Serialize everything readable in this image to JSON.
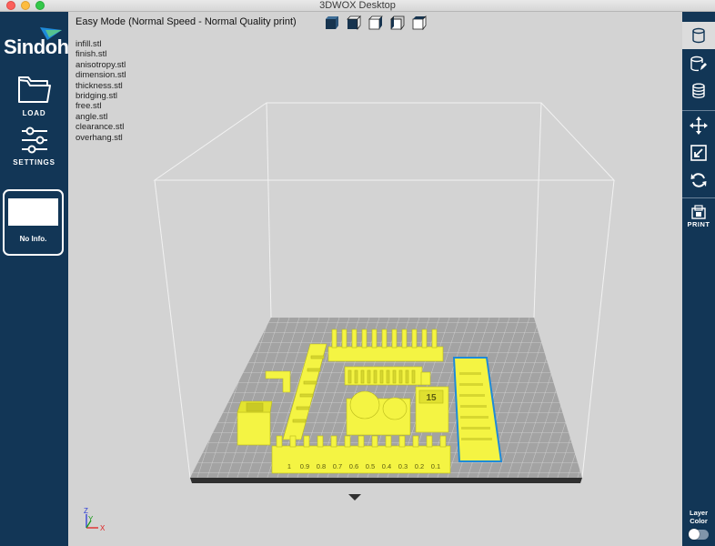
{
  "window": {
    "title": "3DWOX Desktop",
    "controls": {
      "close_color": "#fc605c",
      "minimize_color": "#fdbc40",
      "zoom_color": "#34c84a"
    }
  },
  "sidebar": {
    "brand": "Sindoh",
    "load_label": "LOAD",
    "settings_label": "SETTINGS",
    "info_label": "No Info."
  },
  "toolbar_right": {
    "items": [
      {
        "name": "cylinder-view",
        "icon": "cylinder-icon",
        "active": true
      },
      {
        "name": "edit-model",
        "icon": "cylinder-pencil-icon",
        "active": false
      },
      {
        "name": "layers",
        "icon": "stack-icon",
        "active": false
      },
      {
        "name": "move",
        "icon": "move-arrows-icon",
        "active": false
      },
      {
        "name": "scale",
        "icon": "scale-icon",
        "active": false
      },
      {
        "name": "rotate",
        "icon": "rotate-icon",
        "active": false
      }
    ],
    "print_label": "PRINT",
    "layer_color_label_1": "Layer",
    "layer_color_label_2": "Color"
  },
  "viewport": {
    "mode_title": "Easy Mode (Normal Speed - Normal Quality print)",
    "files": [
      "infill.stl",
      "finish.stl",
      "anisotropy.stl",
      "dimension.stl",
      "thickness.stl",
      "bridging.stl",
      "free.stl",
      "angle.stl",
      "clearance.stl",
      "overhang.stl"
    ],
    "view_cubes": [
      "iso-view",
      "front-view",
      "left-view",
      "right-view",
      "top-view"
    ],
    "model_color": "#f4f443",
    "bed_color": "#9c9c9c",
    "clearance_labels": [
      "1",
      "0.9",
      "0.8",
      "0.7",
      "0.6",
      "0.5",
      "0.4",
      "0.3",
      "0.2",
      "0.1"
    ],
    "thickness_label": "15",
    "axis": {
      "z": "Z",
      "y": "Y",
      "x": "X"
    }
  },
  "colors": {
    "sidebar_bg": "#123656",
    "viewport_bg": "#d3d3d3",
    "accent_blue": "#1e8ad8",
    "brand_green": "#56c38f"
  }
}
